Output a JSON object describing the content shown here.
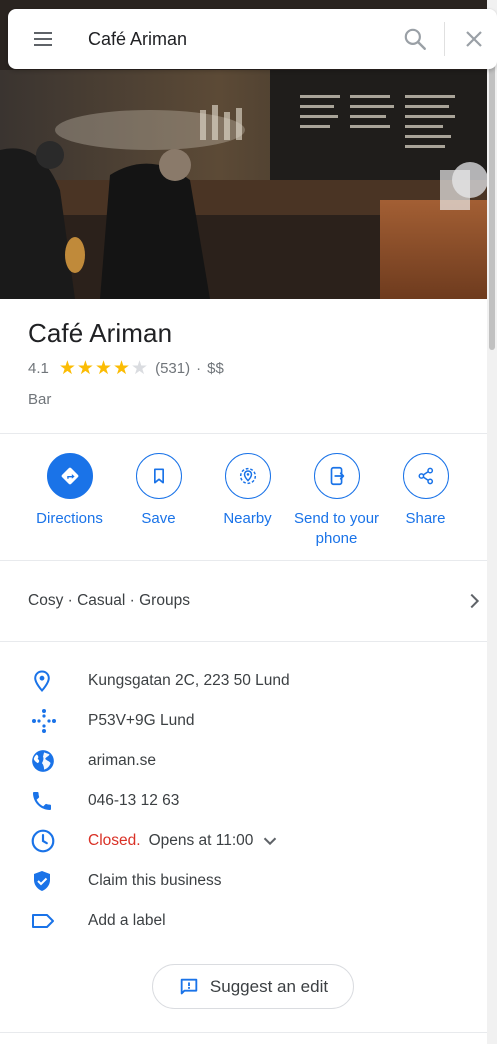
{
  "search": {
    "query": "Café Ariman"
  },
  "photo": {
    "alt_icon": "restaurant-photo"
  },
  "place": {
    "name": "Café Ariman",
    "rating": "4.1",
    "rating_value": 4.1,
    "reviews": "(531)",
    "separator": "·",
    "price": "$$",
    "category": "Bar"
  },
  "actions": [
    {
      "label": "Directions",
      "icon": "directions-icon"
    },
    {
      "label": "Save",
      "icon": "bookmark-icon"
    },
    {
      "label": "Nearby",
      "icon": "nearby-icon"
    },
    {
      "label": "Send to your phone",
      "icon": "send-to-phone-icon"
    },
    {
      "label": "Share",
      "icon": "share-icon"
    }
  ],
  "attributes": {
    "text": "Cosy · Casual · Groups"
  },
  "details": {
    "address": "Kungsgatan 2C, 223 50 Lund",
    "plus_code": "P53V+9G Lund",
    "website": "ariman.se",
    "phone": "046-13 12 63",
    "hours_status": "Closed.",
    "hours_next": "Opens at 11:00",
    "claim": "Claim this business",
    "label": "Add a label"
  },
  "suggest": {
    "label": "Suggest an edit"
  },
  "colors": {
    "accent": "#1a73e8",
    "closed": "#d93025",
    "star": "#fbbc04"
  }
}
